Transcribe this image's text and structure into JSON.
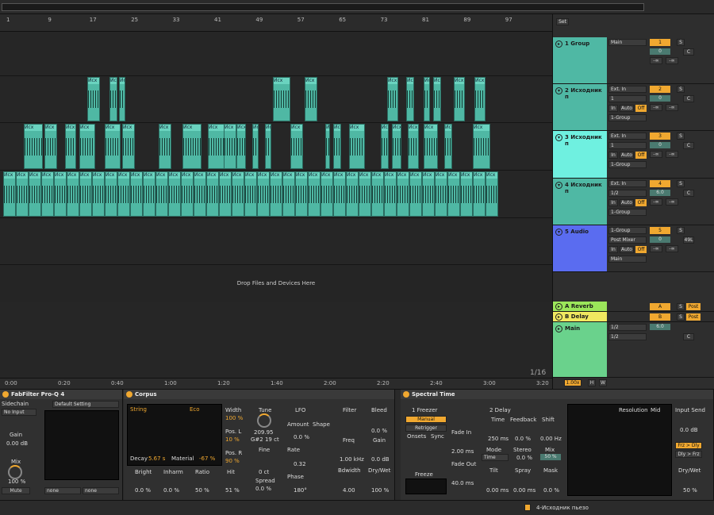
{
  "ruler": {
    "bars": [
      "1",
      "9",
      "17",
      "25",
      "33",
      "41",
      "49",
      "57",
      "65",
      "73",
      "81",
      "89",
      "97"
    ]
  },
  "timeline": {
    "times": [
      "0:00",
      "0:20",
      "0:40",
      "1:00",
      "1:20",
      "1:40",
      "2:00",
      "2:20",
      "2:40",
      "3:00",
      "3:20"
    ],
    "ratio": "1/16"
  },
  "drop_text": "Drop Files and Devices Here",
  "mixer": {
    "set_label": "Set",
    "tracks": [
      {
        "name": "1 Group",
        "num": "1",
        "io1": "Main",
        "vol": "0",
        "pan": "C",
        "peak1": "-∞",
        "peak2": "-∞"
      },
      {
        "name": "2 Исходник п",
        "num": "2",
        "io1": "Ext. In",
        "io2": "1",
        "io3": "1-Group",
        "vol": "0",
        "pan": "C",
        "peak1": "-∞",
        "peak2": "-∞"
      },
      {
        "name": "3 Исходник п",
        "num": "3",
        "io1": "Ext. In",
        "io2": "1",
        "io3": "1-Group",
        "vol": "0",
        "pan": "C",
        "peak1": "-∞",
        "peak2": "-∞"
      },
      {
        "name": "4 Исходник п",
        "num": "4",
        "io1": "Ext. In",
        "io2": "1/2",
        "io3": "1-Group",
        "vol": "6.0",
        "pan": "C",
        "peak1": "-∞",
        "peak2": "-∞"
      },
      {
        "name": "5 Audio",
        "num": "5",
        "io1": "1-Group",
        "io2": "Post Mixer",
        "io3": "Main",
        "vol": "0",
        "pan": "49L",
        "peak1": "-∞",
        "peak2": "-∞"
      }
    ],
    "returns": [
      {
        "name": "A Reverb",
        "letter": "A",
        "post": "Post"
      },
      {
        "name": "B Delay",
        "letter": "B",
        "post": "Post"
      }
    ],
    "main": {
      "name": "Main",
      "io1": "1/2",
      "io2": "1/2",
      "vol": "6.0",
      "pan": "C"
    },
    "in_label": "In",
    "auto_label": "Auto",
    "off_label": "Off",
    "s_label": "S",
    "zoom": "1.00x",
    "h": "H",
    "w": "W"
  },
  "clip_label": "Исх",
  "devices": {
    "proq": {
      "title": "FabFilter Pro-Q 4",
      "sidechain": "Sidechain",
      "input": "No Input",
      "preset": "Default Setting",
      "gain_label": "Gain",
      "gain": "0.00 dB",
      "mix_label": "Mix",
      "mix": "100 %",
      "mute": "Mute",
      "none1": "none",
      "none2": "none"
    },
    "corpus": {
      "title": "Corpus",
      "type": "String",
      "mode": "Eco",
      "width_label": "Width",
      "width": "100 %",
      "posl_label": "Pos. L",
      "posl": "10 %",
      "posr_label": "Pos. R",
      "posr": "90 %",
      "decay_label": "Decay",
      "decay": "5.67 s",
      "material_label": "Material",
      "material": "-67 %",
      "tune_label": "Tune",
      "tune": "209.95",
      "note": "G#2 19 ct",
      "fine_label": "Fine",
      "fine": "0 ct",
      "spread_label": "Spread",
      "spread": "0.0 %",
      "lfo": "LFO",
      "amount_label": "Amount",
      "amount": "0.0 %",
      "shape_label": "Shape",
      "rate_label": "Rate",
      "rate": "0.32",
      "phase_label": "Phase",
      "phase": "180°",
      "filter": "Filter",
      "freq_label": "Freq",
      "freq": "1.00 kHz",
      "bw_label": "Bdwidth",
      "bw": "4.00",
      "bleed_label": "Bleed",
      "bleed": "0.0 %",
      "gain_label": "Gain",
      "gain": "0.0 dB",
      "drywet_label": "Dry/Wet",
      "drywet": "100 %",
      "bright_label": "Bright",
      "bright": "0.0 %",
      "inharm_label": "Inharm",
      "inharm": "0.0 %",
      "ratio_label": "Ratio",
      "ratio": "50 %",
      "hit_label": "Hit",
      "hit": "51 %",
      "opacity": "0.0 %"
    },
    "spectral": {
      "title": "Spectral Time",
      "freezer": "1 Freezer",
      "manual": "Manual",
      "retrigger": "Retrigger",
      "onsets": "Onsets",
      "sync": "Sync",
      "fadein_label": "Fade In",
      "fadein": "2.00 ms",
      "fadeout_label": "Fade Out",
      "fadeout": "40.0 ms",
      "freeze": "Freeze",
      "delay": "2 Delay",
      "time_label": "Time",
      "time": "250 ms",
      "fb_label": "Feedback",
      "fb": "0.0 %",
      "shift_label": "Shift",
      "shift": "0.00 Hz",
      "mode_label": "Mode",
      "mode": "Time",
      "stereo_label": "Stereo",
      "stereo": "0.0 %",
      "mix_label": "Mix",
      "mix": "50 %",
      "tilt_label": "Tilt",
      "tilt": "0.00 ms",
      "spray_label": "Spray",
      "spray": "0.00 ms",
      "mask_label": "Mask",
      "mask": "0.0 %",
      "res_label": "Resolution",
      "res": "Mid",
      "insend_label": "Input Send",
      "insend": "0.0 dB",
      "frz_dly": "Frz > Dly",
      "dly_frz": "Dly > Frz",
      "drywet_label": "Dry/Wet",
      "drywet": "50 %"
    }
  },
  "status": {
    "track": "4-Исходник пьезо"
  }
}
